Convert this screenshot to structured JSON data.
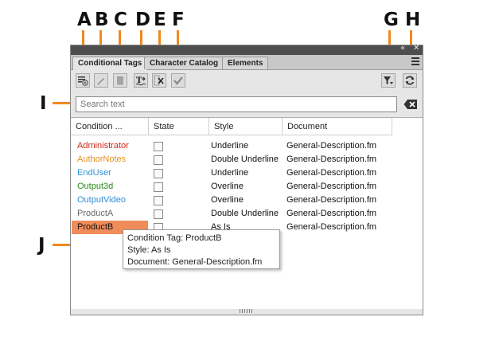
{
  "callouts": [
    "A",
    "B",
    "C",
    "D",
    "E",
    "F",
    "G",
    "H",
    "I",
    "J"
  ],
  "panel": {
    "tabs": [
      "Conditional Tags",
      "Character Catalog",
      "Elements"
    ],
    "collapse_glyph": "«",
    "close_glyph": "✕"
  },
  "icons": {
    "new_tag": "new-condition-tag-icon",
    "edit_tag": "edit-pencil-icon",
    "delete_tag": "trash-icon",
    "apply_tag": "apply-tag-icon",
    "remove_tag": "remove-tag-icon",
    "commit": "checkmark-icon",
    "filter": "filter-icon",
    "refresh": "refresh-icon"
  },
  "search": {
    "placeholder": "Search text"
  },
  "table": {
    "headers": [
      "Condition ...",
      "State",
      "Style",
      "Document"
    ],
    "rows": [
      {
        "name": "Administrator",
        "color": "#cc2a1a",
        "style": "Underline",
        "document": "General-Description.fm"
      },
      {
        "name": "AuthorNotes",
        "color": "#e8901a",
        "style": "Double Underline",
        "document": "General-Description.fm"
      },
      {
        "name": "EndUser",
        "color": "#2e8fd6",
        "style": "Underline",
        "document": "General-Description.fm"
      },
      {
        "name": "Output3d",
        "color": "#2f8a1e",
        "style": "Overline",
        "document": "General-Description.fm"
      },
      {
        "name": "OutputVideo",
        "color": "#2e8fd6",
        "style": "Overline",
        "document": "General-Description.fm"
      },
      {
        "name": "ProductA",
        "color": "#666666",
        "style": "Double Underline",
        "document": "General-Description.fm"
      },
      {
        "name": "ProductB",
        "color": "#111111",
        "style": "As Is",
        "document": "General-Description.fm",
        "selected": true
      }
    ]
  },
  "tooltip": {
    "line1": "Condition Tag: ProductB",
    "line2": "Style: As Is",
    "line3": "Document: General-Description.fm"
  },
  "colors": {
    "accent": "#f0891e",
    "selection": "#f08c5a"
  }
}
